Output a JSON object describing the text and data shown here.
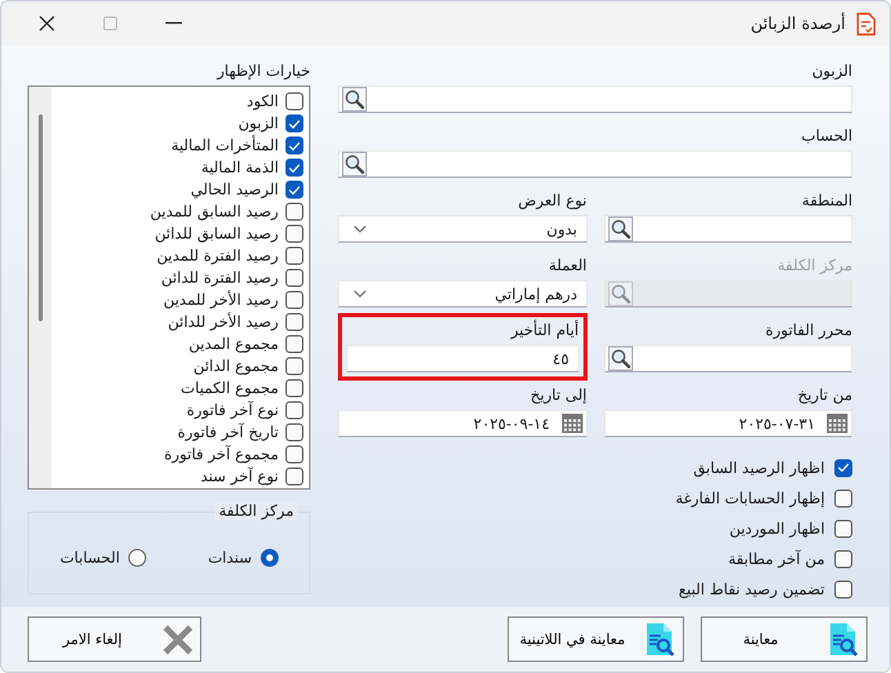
{
  "window": {
    "title": "أرصدة الزبائن"
  },
  "wide_fields": [
    {
      "label": "الزبون",
      "kind": "lookup",
      "disabled": false
    },
    {
      "label": "الحساب",
      "kind": "lookup",
      "disabled": false
    }
  ],
  "field_grid": [
    {
      "label": "المنطقة",
      "kind": "lookup",
      "disabled": false,
      "highlighted": false
    },
    {
      "label": "نوع العرض",
      "kind": "dropdown",
      "value": "بدون",
      "disabled": false,
      "highlighted": false
    },
    {
      "label": "مركز الكلفة",
      "kind": "lookup",
      "disabled": true,
      "highlighted": false
    },
    {
      "label": "العملة",
      "kind": "dropdown",
      "value": "درهم إماراتي",
      "disabled": false,
      "highlighted": false
    },
    {
      "label": "محرر الفاتورة",
      "kind": "lookup",
      "disabled": false,
      "highlighted": false
    },
    {
      "label": "أيام التأخير",
      "kind": "text",
      "value": "٤٥",
      "disabled": false,
      "highlighted": true
    },
    {
      "label": "من تاريخ",
      "kind": "date",
      "value": "٢٠٢٥-٠٧-٣١",
      "disabled": false,
      "highlighted": false
    },
    {
      "label": "إلى تاريخ",
      "kind": "date",
      "value": "٢٠٢٥-٠٩-١٤",
      "disabled": false,
      "highlighted": false
    }
  ],
  "options": [
    {
      "label": "اظهار الرصيد السابق",
      "checked": true
    },
    {
      "label": "إظهار الحسابات الفارغة",
      "checked": false
    },
    {
      "label": "اظهار الموردين",
      "checked": false
    },
    {
      "label": "من آخر مطابقة",
      "checked": false
    },
    {
      "label": "تضمين رصيد نقاط البيع",
      "checked": false
    }
  ],
  "display_options": {
    "title": "خيارات الإظهار",
    "items": [
      {
        "label": "الكود",
        "checked": false
      },
      {
        "label": "الزبون",
        "checked": true
      },
      {
        "label": "المتأخرات المالية",
        "checked": true
      },
      {
        "label": "الذمة المالية",
        "checked": true
      },
      {
        "label": "الرصيد الحالي",
        "checked": true
      },
      {
        "label": "رصيد السابق للمدين",
        "checked": false
      },
      {
        "label": "رصيد السابق للدائن",
        "checked": false
      },
      {
        "label": "رصيد الفترة للمدين",
        "checked": false
      },
      {
        "label": "رصيد الفترة للدائن",
        "checked": false
      },
      {
        "label": "رصيد الأخر للمدين",
        "checked": false
      },
      {
        "label": "رصيد الأخر للدائن",
        "checked": false
      },
      {
        "label": "مجموع المدين",
        "checked": false
      },
      {
        "label": "مجموع الدائن",
        "checked": false
      },
      {
        "label": "مجموع الكميات",
        "checked": false
      },
      {
        "label": "نوع آخر فاتورة",
        "checked": false
      },
      {
        "label": "تاريخ آخر فاتورة",
        "checked": false
      },
      {
        "label": "مجموع آخر فاتورة",
        "checked": false
      },
      {
        "label": "نوع آخر سند",
        "checked": false
      }
    ]
  },
  "cost_center_group": {
    "title": "مركز الكلفة",
    "radios": [
      {
        "label": "سندات",
        "selected": true
      },
      {
        "label": "الحسابات",
        "selected": false
      }
    ]
  },
  "buttons": [
    {
      "label": "معاينة",
      "kind": "preview"
    },
    {
      "label": "معاينة في اللاتينية",
      "kind": "preview"
    },
    {
      "label": "إلغاء الامر",
      "kind": "cancel"
    }
  ]
}
